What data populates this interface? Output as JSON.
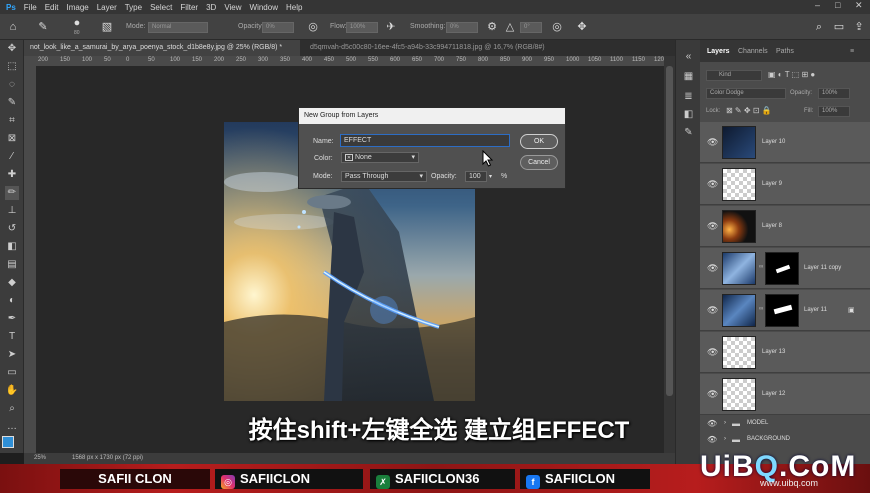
{
  "menu": [
    "File",
    "Edit",
    "Image",
    "Layer",
    "Type",
    "Select",
    "Filter",
    "3D",
    "View",
    "Window",
    "Help"
  ],
  "options_bar": {
    "brush_size": "80",
    "mode_label": "Mode:",
    "mode_value": "Normal",
    "opacity_label": "Opacity:",
    "opacity_value": "0%",
    "flow_label": "Flow:",
    "flow_value": "100%",
    "smoothing_label": "Smoothing:",
    "smoothing_value": "0%",
    "angle_value": "0°"
  },
  "tabs": [
    {
      "label": "not_look_like_a_samurai_by_arya_poenya_stock_d1b8e8y.jpg @ 25% (RGB/8) *",
      "active": true
    },
    {
      "label": "d5qmvah-d5c00c80-16ee-4fc5-a94b-33c994711818.jpg @ 16,7% (RGB/8#)",
      "active": false
    }
  ],
  "ruler": [
    "200",
    "150",
    "100",
    "50",
    "0",
    "50",
    "100",
    "150",
    "200",
    "250",
    "300",
    "350",
    "400",
    "450",
    "500",
    "550",
    "600",
    "650",
    "700",
    "750",
    "800",
    "850",
    "900",
    "950",
    "1000",
    "1050",
    "1100",
    "1150",
    "1200"
  ],
  "status": {
    "zoom": "25%",
    "info": "1568 px x 1730 px (72 ppi)"
  },
  "subtitle": "按住shift+左键全选 建立组EFFECT",
  "dialog": {
    "title": "New Group from Layers",
    "name_label": "Name:",
    "name_value": "EFFECT",
    "color_label": "Color:",
    "color_value": "None",
    "mode_label": "Mode:",
    "mode_value": "Pass Through",
    "opacity_label": "Opacity:",
    "opacity_value": "100",
    "opacity_unit": "%",
    "ok": "OK",
    "cancel": "Cancel"
  },
  "layers_panel": {
    "tabs": [
      "Layers",
      "Channels",
      "Paths"
    ],
    "filter_placeholder": "Kind",
    "blend_mode": "Color Dodge",
    "opacity_label": "Opacity:",
    "opacity_value": "100%",
    "lock_label": "Lock:",
    "fill_label": "Fill:",
    "fill_value": "100%",
    "layers": [
      {
        "name": "Layer 10"
      },
      {
        "name": "Layer 9"
      },
      {
        "name": "Layer 8"
      },
      {
        "name": "Layer 11 copy"
      },
      {
        "name": "Layer 11"
      },
      {
        "name": "Layer 13"
      },
      {
        "name": "Layer 12"
      }
    ],
    "groups": [
      {
        "name": "MODEL"
      },
      {
        "name": "BACKGROUND"
      }
    ]
  },
  "banner": [
    {
      "name": "SAFII CLON"
    },
    {
      "name": "SAFIICLON",
      "icon": "instagram-icon"
    },
    {
      "name": "SAFIICLON36",
      "icon": "xing-icon"
    },
    {
      "name": "SAFIICLON",
      "icon": "facebook-icon"
    }
  ],
  "watermark": {
    "main_a": "UiB",
    "main_o": "Q",
    "main_b": ".CoM",
    "sub": "www.uibq.com"
  },
  "colors": {
    "accent": "#2d6dc4",
    "banner_red": "#b71d1d",
    "foreground_swatch": "#2f8fd6"
  }
}
